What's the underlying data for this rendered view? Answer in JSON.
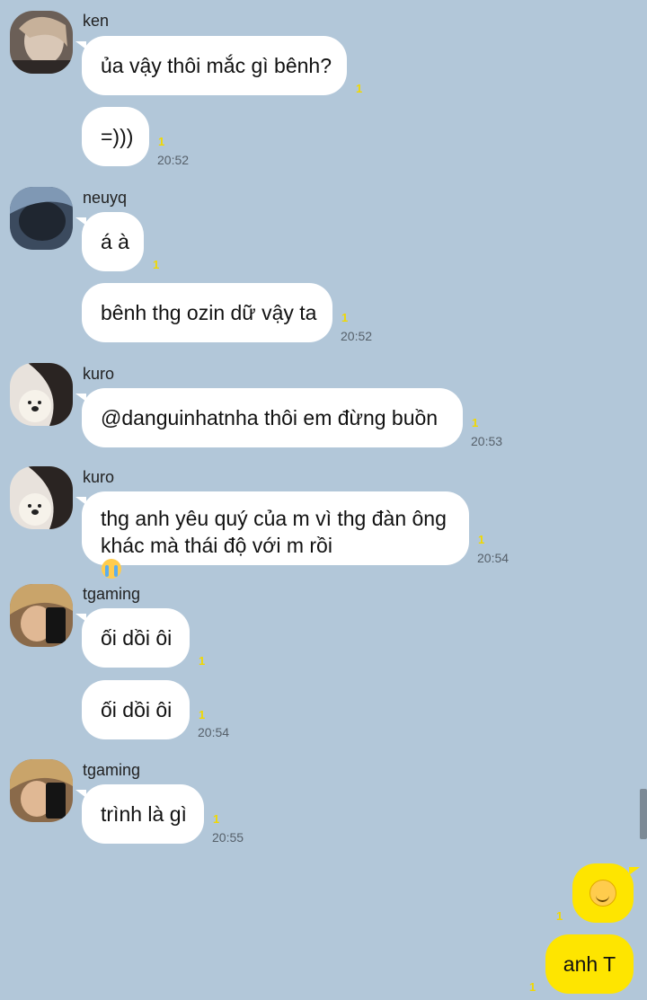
{
  "colors": {
    "background": "#b2c7d9",
    "incoming_bubble": "#ffffff",
    "outgoing_bubble": "#fee500",
    "unread_count": "#f1d800"
  },
  "messages": [
    {
      "sender": "ken",
      "avatar": "avatar-ken",
      "bubbles": [
        {
          "text": "ủa vậy thôi mắc gì bênh?",
          "unread": "1"
        },
        {
          "text": "=)))",
          "unread": "1",
          "time": "20:52"
        }
      ]
    },
    {
      "sender": "neuyq",
      "avatar": "avatar-neuyq",
      "bubbles": [
        {
          "text": "á à",
          "unread": "1"
        },
        {
          "text": "bênh thg ozin dữ vậy ta",
          "unread": "1",
          "time": "20:52"
        }
      ]
    },
    {
      "sender": "kuro",
      "avatar": "avatar-kuro",
      "bubbles": [
        {
          "text": "@danguinhatnha thôi em đừng buồn",
          "unread": "1",
          "time": "20:53"
        }
      ]
    },
    {
      "sender": "kuro",
      "avatar": "avatar-kuro",
      "bubbles": [
        {
          "line1": "thg anh yêu quý của m vì thg đàn ông",
          "line2": "khác mà thái độ với m rồi",
          "emoji": "crying-face-icon",
          "unread": "1",
          "time": "20:54"
        }
      ]
    },
    {
      "sender": "tgaming",
      "avatar": "avatar-tgaming",
      "bubbles": [
        {
          "text": "ối dồi ôi",
          "unread": "1"
        },
        {
          "text": "ối dồi ôi",
          "unread": "1",
          "time": "20:54"
        }
      ]
    },
    {
      "sender": "tgaming",
      "avatar": "avatar-tgaming",
      "bubbles": [
        {
          "text": "trình là gì",
          "unread": "1",
          "time": "20:55"
        }
      ]
    }
  ],
  "outgoing": [
    {
      "emoji": "smiling-blush-face-icon",
      "unread": "1"
    },
    {
      "text": "anh T",
      "unread": "1"
    }
  ]
}
